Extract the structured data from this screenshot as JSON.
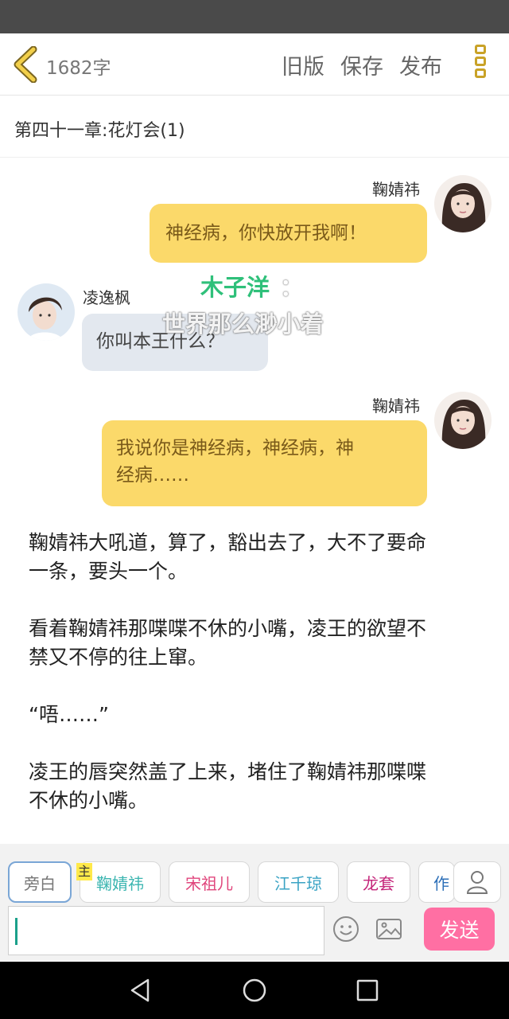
{
  "header": {
    "word_count": "1682字",
    "old_version": "旧版",
    "save": "保存",
    "publish": "发布"
  },
  "chapter": {
    "title": "第四十一章:花灯会(1)"
  },
  "messages": [
    {
      "speaker": "鞠婧祎",
      "side": "right",
      "text": "神经病，你快放开我啊！"
    },
    {
      "speaker": "凌逸枫",
      "side": "left",
      "text": "你叫本王什么？"
    },
    {
      "speaker": "鞠婧祎",
      "side": "right",
      "text_line1": "我说你是神经病，神经病，神",
      "text_line2": "经病……"
    }
  ],
  "overlay": {
    "name": "木子洋",
    "colon": "：",
    "line": "世界那么渺小着"
  },
  "narration": [
    {
      "line1": "鞠婧祎大吼道，算了，豁出去了，大不了要命",
      "line2": "一条，要头一个。"
    },
    {
      "line1": "看着鞠婧祎那喋喋不休的小嘴，凌王的欲望不",
      "line2": "禁又不停的往上窜。"
    },
    {
      "line1": "“唔……”"
    },
    {
      "line1": "凌王的唇突然盖了上来，堵住了鞠婧祎那喋喋",
      "line2": "不休的小嘴。"
    }
  ],
  "roles": {
    "main_tag": "主",
    "chips": [
      "旁白",
      "鞠婧祎",
      "宋祖儿",
      "江千琼",
      "龙套",
      "作"
    ],
    "chip_colors": [
      "#777777",
      "#3bb5b0",
      "#e0467c",
      "#3aa3c4",
      "#c4257a",
      "#2c6fb8"
    ]
  },
  "composer": {
    "input_value": "",
    "send_label": "发送"
  },
  "icons": {
    "back": "chevron-left-icon",
    "more": "vertical-menu-icon",
    "user": "person-icon",
    "emoji": "smiley-icon",
    "image": "image-icon"
  },
  "colors": {
    "accent_gold": "#c9a227",
    "bubble_right": "#fbd96a",
    "bubble_left": "#e3e8ef",
    "send": "#ff6fa3"
  }
}
